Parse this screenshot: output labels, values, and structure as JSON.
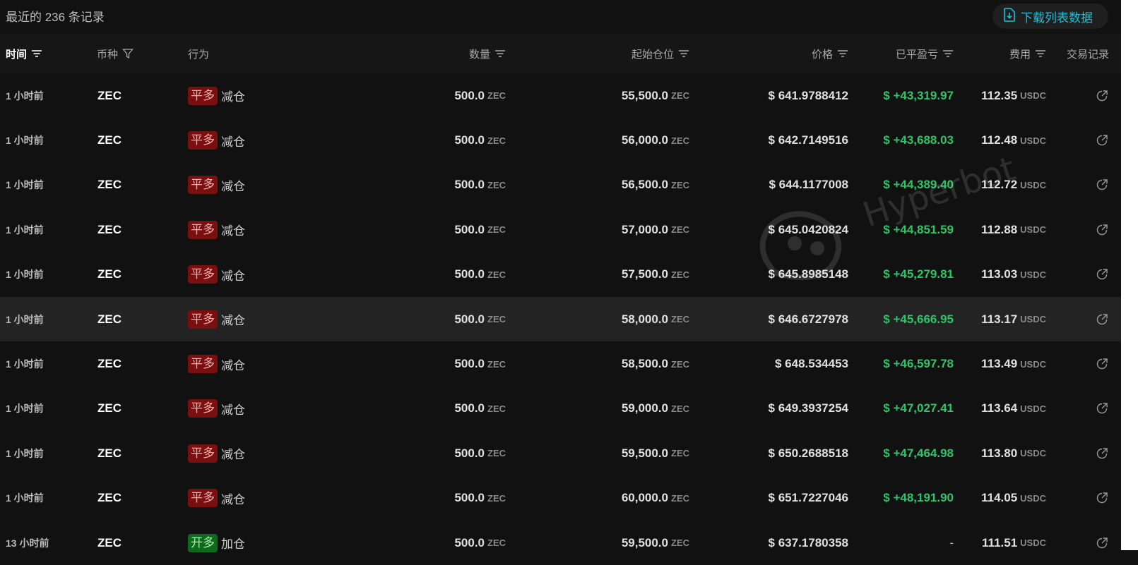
{
  "header": {
    "record_count": "最近的 236 条记录",
    "download_label": "下载列表数据"
  },
  "columns": {
    "time": "时间",
    "coin": "币种",
    "action": "行为",
    "amount": "数量",
    "start_position": "起始仓位",
    "price": "价格",
    "realized_pnl": "已平盈亏",
    "fee": "费用",
    "trade_record": "交易记录"
  },
  "watermark": "Hyperbot",
  "rows": [
    {
      "time": "1 小时前",
      "coin": "ZEC",
      "badge": "平多",
      "badge_type": "close",
      "action": "减仓",
      "amount": "500.0",
      "amount_unit": "ZEC",
      "start": "55,500.0",
      "start_unit": "ZEC",
      "price": "$ 641.9788412",
      "pnl": "$ +43,319.97",
      "fee": "112.35",
      "fee_unit": "USDC"
    },
    {
      "time": "1 小时前",
      "coin": "ZEC",
      "badge": "平多",
      "badge_type": "close",
      "action": "减仓",
      "amount": "500.0",
      "amount_unit": "ZEC",
      "start": "56,000.0",
      "start_unit": "ZEC",
      "price": "$ 642.7149516",
      "pnl": "$ +43,688.03",
      "fee": "112.48",
      "fee_unit": "USDC"
    },
    {
      "time": "1 小时前",
      "coin": "ZEC",
      "badge": "平多",
      "badge_type": "close",
      "action": "减仓",
      "amount": "500.0",
      "amount_unit": "ZEC",
      "start": "56,500.0",
      "start_unit": "ZEC",
      "price": "$ 644.1177008",
      "pnl": "$ +44,389.40",
      "fee": "112.72",
      "fee_unit": "USDC"
    },
    {
      "time": "1 小时前",
      "coin": "ZEC",
      "badge": "平多",
      "badge_type": "close",
      "action": "减仓",
      "amount": "500.0",
      "amount_unit": "ZEC",
      "start": "57,000.0",
      "start_unit": "ZEC",
      "price": "$ 645.0420824",
      "pnl": "$ +44,851.59",
      "fee": "112.88",
      "fee_unit": "USDC"
    },
    {
      "time": "1 小时前",
      "coin": "ZEC",
      "badge": "平多",
      "badge_type": "close",
      "action": "减仓",
      "amount": "500.0",
      "amount_unit": "ZEC",
      "start": "57,500.0",
      "start_unit": "ZEC",
      "price": "$ 645.8985148",
      "pnl": "$ +45,279.81",
      "fee": "113.03",
      "fee_unit": "USDC"
    },
    {
      "time": "1 小时前",
      "coin": "ZEC",
      "badge": "平多",
      "badge_type": "close",
      "action": "减仓",
      "amount": "500.0",
      "amount_unit": "ZEC",
      "start": "58,000.0",
      "start_unit": "ZEC",
      "price": "$ 646.6727978",
      "pnl": "$ +45,666.95",
      "fee": "113.17",
      "fee_unit": "USDC",
      "highlight": true
    },
    {
      "time": "1 小时前",
      "coin": "ZEC",
      "badge": "平多",
      "badge_type": "close",
      "action": "减仓",
      "amount": "500.0",
      "amount_unit": "ZEC",
      "start": "58,500.0",
      "start_unit": "ZEC",
      "price": "$ 648.534453",
      "pnl": "$ +46,597.78",
      "fee": "113.49",
      "fee_unit": "USDC"
    },
    {
      "time": "1 小时前",
      "coin": "ZEC",
      "badge": "平多",
      "badge_type": "close",
      "action": "减仓",
      "amount": "500.0",
      "amount_unit": "ZEC",
      "start": "59,000.0",
      "start_unit": "ZEC",
      "price": "$ 649.3937254",
      "pnl": "$ +47,027.41",
      "fee": "113.64",
      "fee_unit": "USDC"
    },
    {
      "time": "1 小时前",
      "coin": "ZEC",
      "badge": "平多",
      "badge_type": "close",
      "action": "减仓",
      "amount": "500.0",
      "amount_unit": "ZEC",
      "start": "59,500.0",
      "start_unit": "ZEC",
      "price": "$ 650.2688518",
      "pnl": "$ +47,464.98",
      "fee": "113.80",
      "fee_unit": "USDC"
    },
    {
      "time": "1 小时前",
      "coin": "ZEC",
      "badge": "平多",
      "badge_type": "close",
      "action": "减仓",
      "amount": "500.0",
      "amount_unit": "ZEC",
      "start": "60,000.0",
      "start_unit": "ZEC",
      "price": "$ 651.7227046",
      "pnl": "$ +48,191.90",
      "fee": "114.05",
      "fee_unit": "USDC"
    },
    {
      "time": "13 小时前",
      "coin": "ZEC",
      "badge": "开多",
      "badge_type": "open",
      "action": "加仓",
      "amount": "500.0",
      "amount_unit": "ZEC",
      "start": "59,500.0",
      "start_unit": "ZEC",
      "price": "$ 637.1780358",
      "pnl": "-",
      "fee": "111.51",
      "fee_unit": "USDC"
    }
  ],
  "colors": {
    "background": "#111111",
    "header_bg": "#161616",
    "highlight_row": "#232323",
    "accent_cyan": "#1fbfd9",
    "profit_green": "#2ec46a",
    "badge_close_bg": "#7a0f0f",
    "badge_open_bg": "#0f6a1f"
  }
}
